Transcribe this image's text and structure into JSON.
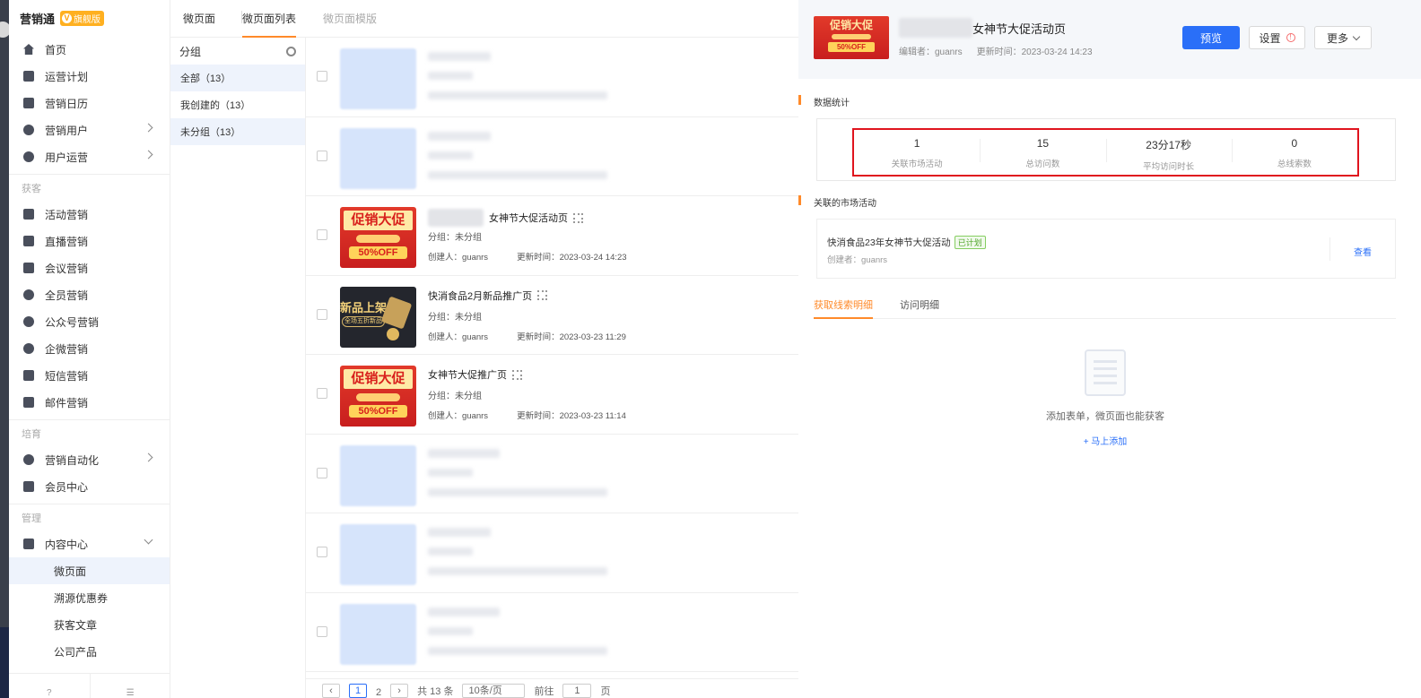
{
  "brand": {
    "name": "营销通",
    "badge": "旗舰版"
  },
  "sidebar": {
    "items": [
      {
        "label": "首页",
        "icon": "home-icon"
      },
      {
        "label": "运营计划",
        "icon": "plan-icon"
      },
      {
        "label": "营销日历",
        "icon": "calendar-icon"
      },
      {
        "label": "营销用户",
        "icon": "users-icon",
        "expandable": true
      },
      {
        "label": "用户运营",
        "icon": "user-ops-icon",
        "expandable": true
      }
    ],
    "group_acquire": "获客",
    "acquire_items": [
      {
        "label": "活动营销",
        "icon": "doc-icon"
      },
      {
        "label": "直播营销",
        "icon": "live-icon"
      },
      {
        "label": "会议营销",
        "icon": "meeting-icon"
      },
      {
        "label": "全员营销",
        "icon": "team-icon"
      },
      {
        "label": "公众号营销",
        "icon": "wechat-icon"
      },
      {
        "label": "企微营销",
        "icon": "chat-icon"
      },
      {
        "label": "短信营销",
        "icon": "sms-icon"
      },
      {
        "label": "邮件营销",
        "icon": "mail-icon"
      }
    ],
    "group_nurture": "培育",
    "nurture_items": [
      {
        "label": "营销自动化",
        "icon": "automation-icon",
        "expandable": true
      },
      {
        "label": "会员中心",
        "icon": "member-icon"
      }
    ],
    "group_manage": "管理",
    "manage_item": {
      "label": "内容中心",
      "icon": "content-icon"
    },
    "sub_items": [
      "微页面",
      "溯源优惠券",
      "获客文章",
      "公司产品"
    ],
    "active_sub": "微页面"
  },
  "tabs": [
    "微页面",
    "微页面列表",
    "微页面模版"
  ],
  "groups": {
    "header": "分组",
    "items": [
      "全部（13）",
      "我创建的（13）",
      "未分组（13）"
    ]
  },
  "list": {
    "rows": [
      {
        "title": "女神节大促活动页",
        "group": "分组：未分组",
        "creator": "创建人：guanrs",
        "updated": "更新时间：2023-03-24 14:23",
        "thumb": "promo"
      },
      {
        "title": "快消食品2月新品推广页",
        "group": "分组：未分组",
        "creator": "创建人：guanrs",
        "updated": "更新时间：2023-03-23 11:29",
        "thumb": "newproduct"
      },
      {
        "title": "女神节大促推广页",
        "group": "分组：未分组",
        "creator": "创建人：guanrs",
        "updated": "更新时间：2023-03-23 11:14",
        "thumb": "promo"
      }
    ],
    "thumb_promo_text": "促销大促",
    "thumb_promo_sub": "50%OFF",
    "thumb_new_text": "新品上架",
    "thumb_new_sub": "全场五折新品"
  },
  "pager": {
    "pages": [
      "1",
      "2"
    ],
    "total": "共 13 条",
    "page_size": "10条/页",
    "goto": "前往",
    "goto_value": "1",
    "unit": "页"
  },
  "panel": {
    "title": "女神节大促活动页",
    "editor": "编辑者：guanrs",
    "updated": "更新时间：2023-03-24 14:23",
    "buttons": {
      "preview": "预览",
      "settings": "设置",
      "more": "更多"
    },
    "stats_title": "数据统计",
    "stats": [
      {
        "value": "1",
        "label": "关联市场活动"
      },
      {
        "value": "15",
        "label": "总访问数"
      },
      {
        "value": "23分17秒",
        "label": "平均访问时长"
      },
      {
        "value": "0",
        "label": "总线索数"
      }
    ],
    "related_title": "关联的市场活动",
    "activity": {
      "title": "快消食品23年女神节大促活动",
      "tag": "已计划",
      "creator": "创建者：guanrs",
      "link": "查看"
    },
    "tabs": [
      "获取线索明细",
      "访问明细"
    ],
    "empty_text": "添加表单，微页面也能获客",
    "empty_link": "+ 马上添加"
  },
  "colors": {
    "primary": "#2a6ff8",
    "accent": "#ff8a2a",
    "highlight": "#e0141e",
    "active_bg": "#eef3fc"
  }
}
